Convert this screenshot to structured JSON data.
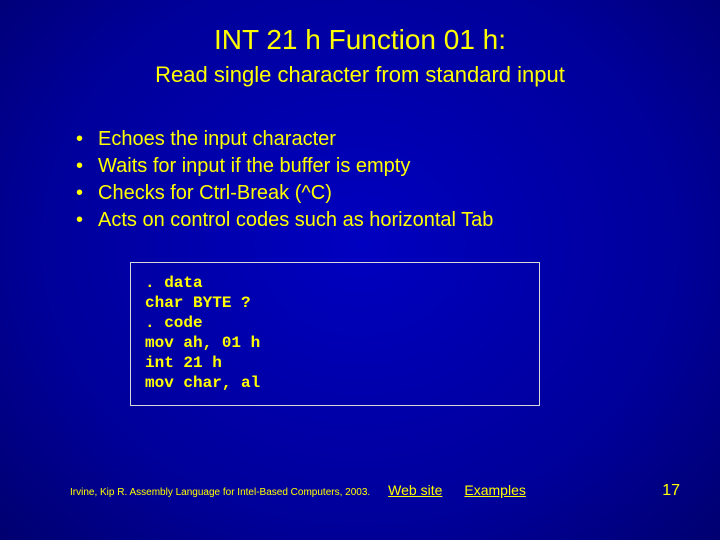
{
  "title": "INT 21 h Function 01 h:",
  "subtitle": "Read single character from standard input",
  "bullets": [
    "Echoes the input character",
    "Waits for input if the buffer is empty",
    "Checks for Ctrl-Break (^C)",
    "Acts on control codes such as horizontal Tab"
  ],
  "code": ". data\nchar BYTE ?\n. code\nmov ah, 01 h\nint 21 h\nmov char, al",
  "footer": {
    "citation": "Irvine, Kip R. Assembly Language for Intel-Based Computers, 2003.",
    "link1": "Web site",
    "link2": "Examples",
    "page": "17"
  }
}
